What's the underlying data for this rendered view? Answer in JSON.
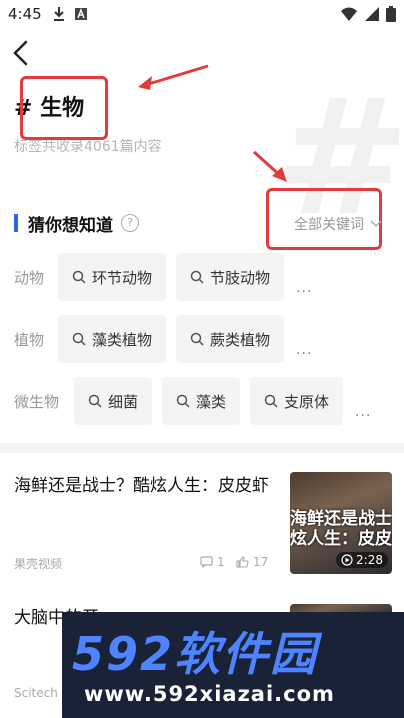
{
  "status": {
    "time": "4:45",
    "icons": [
      "download-icon",
      "a-badge-icon",
      "wifi-icon",
      "signal-icon",
      "battery-icon"
    ]
  },
  "nav": {
    "back_icon": "chevron-left-icon"
  },
  "tag": {
    "title": "# 生物",
    "subtitle": "标签共收录4061篇内容"
  },
  "section": {
    "title": "猜你想知道",
    "all_keywords": "全部关键词"
  },
  "categories": [
    {
      "label": "动物",
      "chips": [
        "环节动物",
        "节肢动物"
      ]
    },
    {
      "label": "植物",
      "chips": [
        "藻类植物",
        "蕨类植物"
      ]
    },
    {
      "label": "微生物",
      "chips": [
        "细菌",
        "藻类",
        "支原体"
      ]
    }
  ],
  "more_label": "...",
  "articles": [
    {
      "title": "海鲜还是战士？酷炫人生：皮皮虾",
      "source": "果壳视频",
      "comments": "1",
      "likes": "17",
      "thumb_text_line1": "海鲜还是战士",
      "thumb_text_line2": "炫人生：皮皮",
      "duration": "2:28"
    },
    {
      "title": "大脑中的开",
      "source": "Scitech"
    }
  ],
  "watermark": {
    "brand": "592软件园",
    "url": "www.592xiazai.com"
  },
  "colors": {
    "accent": "#2e62ff",
    "annotation": "#e23b3b"
  }
}
